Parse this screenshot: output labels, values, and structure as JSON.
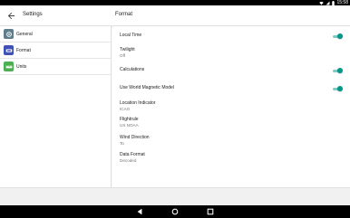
{
  "status_bar": {
    "time": "15:58"
  },
  "app_bar": {
    "left_title": "Settings",
    "right_title": "Format"
  },
  "sidebar": {
    "items": [
      {
        "label": "General",
        "icon": "gear-icon",
        "color": "#607d8b"
      },
      {
        "label": "Format",
        "icon": "format-icon",
        "color": "#3f51b5"
      },
      {
        "label": "Units",
        "icon": "ruler-icon",
        "color": "#4caf50"
      }
    ]
  },
  "content": {
    "prefs": [
      {
        "title": "Local Time",
        "toggle": true,
        "on": true
      },
      {
        "title": "Twilight",
        "subtitle": "Off"
      },
      {
        "title": "Calculations",
        "toggle": true,
        "on": true
      },
      {
        "title": "Use World Magnetic Model",
        "toggle": true,
        "on": true
      },
      {
        "title": "Location Indicator",
        "subtitle": "ICAO"
      },
      {
        "title": "Flightrule",
        "subtitle": "US NOAA"
      },
      {
        "title": "Wind Direction",
        "subtitle": "To"
      },
      {
        "title": "Data Format",
        "subtitle": "Decoded"
      }
    ]
  },
  "colors": {
    "accent": "#009688",
    "accent_track": "#80cbc4"
  }
}
